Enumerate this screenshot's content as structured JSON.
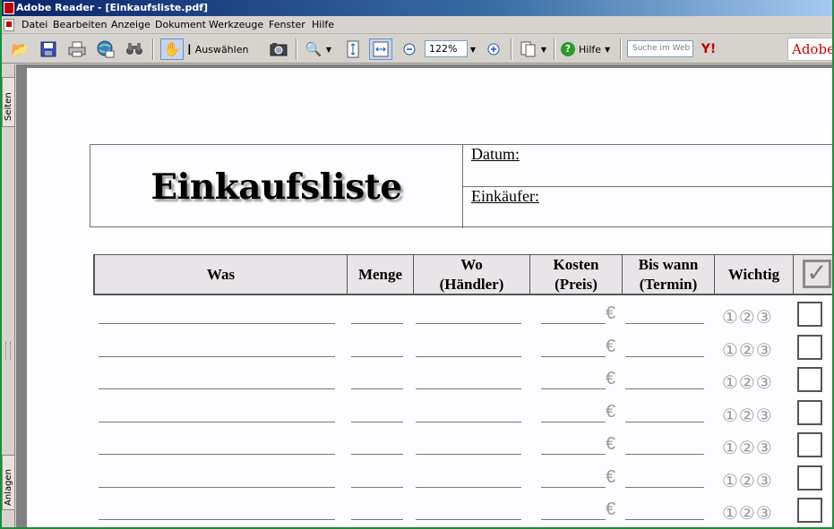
{
  "window": {
    "title": "Adobe Reader - [Einkaufsliste.pdf]"
  },
  "menu": [
    "Datei",
    "Bearbeiten",
    "Anzeige",
    "Dokument",
    "Werkzeuge",
    "Fenster",
    "Hilfe"
  ],
  "toolbar": {
    "select_label": "Auswählen",
    "zoom_value": "122%",
    "help_label": "Hilfe",
    "search_placeholder": "Suche im Web",
    "yahoo_label": "Y!",
    "adobe_label": "Adobe"
  },
  "nav_panel": {
    "pages_tab": "Seiten",
    "attachments_tab": "Anlagen"
  },
  "document": {
    "title": "Einkaufsliste",
    "date_label": "Datum:",
    "buyer_label": "Einkäufer:",
    "columns": [
      {
        "line1": "Was",
        "line2": ""
      },
      {
        "line1": "Menge",
        "line2": ""
      },
      {
        "line1": "Wo",
        "line2": "(Händler)"
      },
      {
        "line1": "Kosten",
        "line2": "(Preis)"
      },
      {
        "line1": "Bis wann",
        "line2": "(Termin)"
      },
      {
        "line1": "Wichtig",
        "line2": ""
      }
    ],
    "header_check_symbol": "✓",
    "currency_symbol": "€",
    "priority_symbols": "①②③",
    "row_count": 7
  }
}
